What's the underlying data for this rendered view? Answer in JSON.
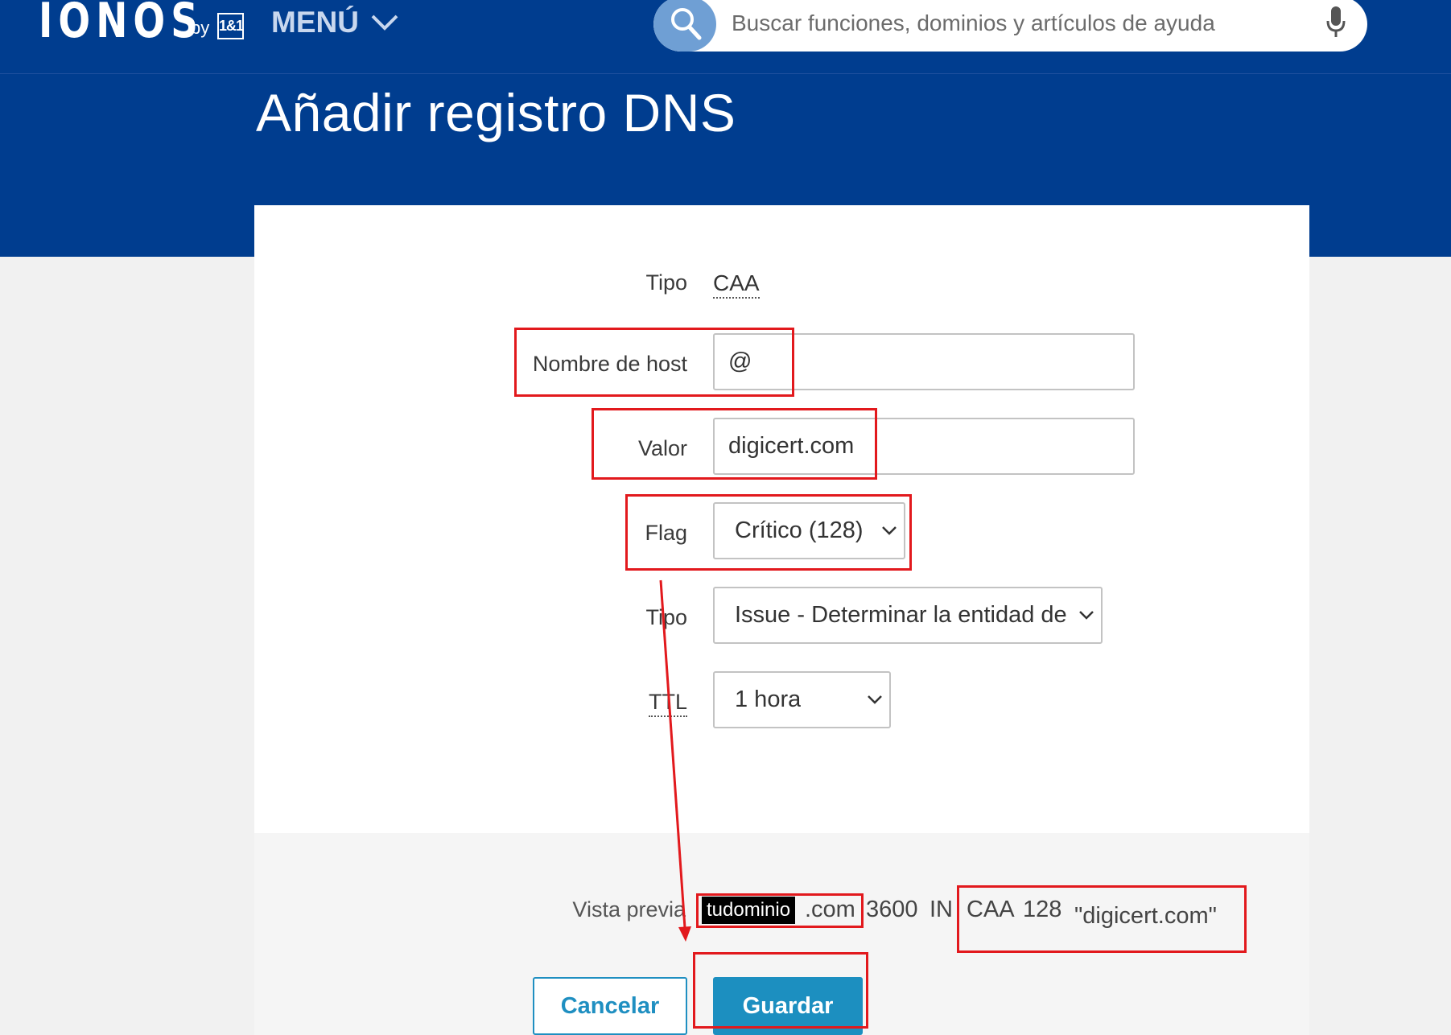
{
  "header": {
    "logo_text": "IONOS",
    "logo_by": "by",
    "logo_mark": "1&1",
    "menu_label": "MENÚ",
    "search_placeholder": "Buscar funciones, dominios y artículos de ayuda",
    "search_icon": "search-icon",
    "mic_icon": "microphone-icon"
  },
  "page": {
    "title": "Añadir registro DNS"
  },
  "form": {
    "type_label": "Tipo",
    "type_value": "CAA",
    "host_label": "Nombre de host",
    "host_value": "@",
    "value_label": "Valor",
    "value_value": "digicert.com",
    "flag_label": "Flag",
    "flag_value": "Crítico (128)",
    "tag_label": "Tipo",
    "tag_value": "Issue - Determinar la entidad de",
    "ttl_label": "TTL",
    "ttl_value": "1 hora"
  },
  "preview": {
    "label": "Vista previa",
    "domain_masked": "tudominio",
    "domain_suffix": ".com",
    "ttl": "3600",
    "class": "IN",
    "type": "CAA",
    "flag": "128",
    "value": "\"digicert.com\""
  },
  "actions": {
    "cancel_label": "Cancelar",
    "save_label": "Guardar"
  },
  "colors": {
    "brand_blue": "#003d8f",
    "button_blue": "#1c8fc0",
    "annotation_red": "#e2191d"
  }
}
